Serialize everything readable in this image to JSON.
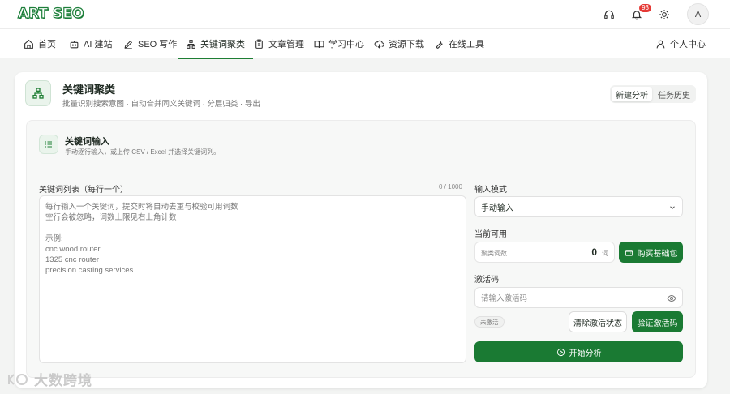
{
  "app": {
    "logo_text": "ART SEO"
  },
  "header": {
    "notification_count": "93",
    "avatar_letter": "A"
  },
  "nav": {
    "items": [
      {
        "label": "首页",
        "icon": "home-icon"
      },
      {
        "label": "AI 建站",
        "icon": "robot-icon"
      },
      {
        "label": "SEO 写作",
        "icon": "pen-icon"
      },
      {
        "label": "关键词聚类",
        "icon": "cluster-icon",
        "active": true
      },
      {
        "label": "文章管理",
        "icon": "clipboard-icon"
      },
      {
        "label": "学习中心",
        "icon": "book-icon"
      },
      {
        "label": "资源下载",
        "icon": "cloud-download-icon"
      },
      {
        "label": "在线工具",
        "icon": "wrench-icon"
      }
    ],
    "user_center": "个人中心"
  },
  "page": {
    "title": "关键词聚类",
    "subtitle": "批量识别搜索意图 · 自动合并同义关键词 · 分层归类 · 导出",
    "tabs": [
      "新建分析",
      "任务历史"
    ]
  },
  "panel": {
    "title": "关键词输入",
    "subtitle": "手动逐行输入，或上传 CSV / Excel 并选择关键词列。"
  },
  "keywords": {
    "label": "关键词列表（每行一个）",
    "count": "0 / 1000",
    "placeholder": "每行输入一个关键词，提交时将自动去重与校验可用词数\n空行会被忽略，词数上限见右上角计数\n\n示例:\ncnc wood router\n1325 cnc router\nprecision casting services"
  },
  "input_mode": {
    "label": "输入模式",
    "value": "手动输入"
  },
  "available": {
    "label": "当前可用",
    "field_label": "聚类词数",
    "value": "0",
    "unit": "词",
    "buy_button": "购买基础包"
  },
  "activation": {
    "label": "激活码",
    "placeholder": "请输入激活码",
    "status": "未激活",
    "clear_button": "清除激活状态",
    "verify_button": "验证激活码"
  },
  "start_button": "开始分析",
  "watermark": "大数跨境",
  "colors": {
    "primary": "#1a7a33",
    "badge": "#e53935"
  }
}
